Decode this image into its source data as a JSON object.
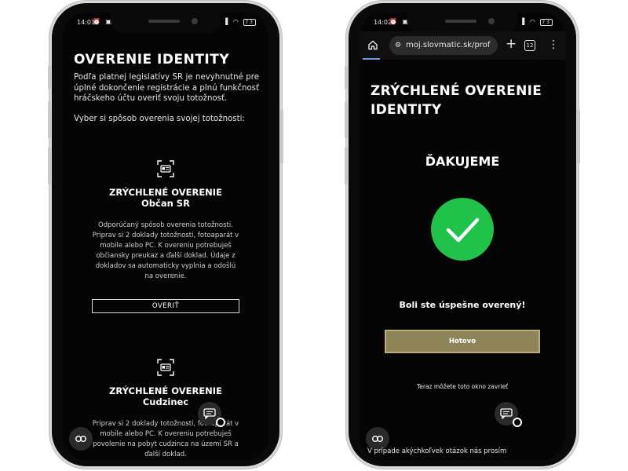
{
  "left_phone": {
    "status": {
      "time": "14:01",
      "battery": "73"
    },
    "title": "OVERENIE IDENTITY",
    "intro": "Podľa platnej legislatívy SR je nevyhnutné pre úplné dokončenie registrácie a plnú funkčnosť hráčskeho účtu overiť svoju totožnosť.",
    "choose": "Vyber si spôsob overenia svojej totožnosti:",
    "card1": {
      "title": "ZRÝCHLENÉ OVERENIE",
      "subtitle": "Občan SR",
      "description": "Odporúčaný spôsob overenia totožnosti. Priprav si 2 doklady totožnosti, fotoaparát v mobile alebo PC. K overeniu potrebuješ občiansky preukaz a ďalší doklad. Údaje z dokladov sa automaticky vyplnia a odošlú na overenie.",
      "button": "OVERIŤ"
    },
    "card2": {
      "title": "ZRÝCHLENÉ OVERENIE",
      "subtitle": "Cudzinec",
      "description": "Priprav si 2 doklady totožnosti, fotoaparát v mobile alebo PC. K overeniu potrebuješ povolenie na pobyt cudzinca na území SR a ďalší doklad."
    }
  },
  "right_phone": {
    "status": {
      "time": "14:02",
      "battery": "73"
    },
    "browser": {
      "url": "moj.slovmatic.sk/prof",
      "tab_count": "12"
    },
    "title": "ZRÝCHLENÉ OVERENIE IDENTITY",
    "thanks": "ĎAKUJEME",
    "success": "Boli ste úspešne overený!",
    "done_button": "Hotovo",
    "close_hint": "Teraz môžete toto okno zavrieť",
    "bottom_text": "V prípade akýchkoľvek otázok nás prosím"
  },
  "colors": {
    "success_green": "#20c24a",
    "done_button": "#8e8359",
    "background": "#050505"
  }
}
